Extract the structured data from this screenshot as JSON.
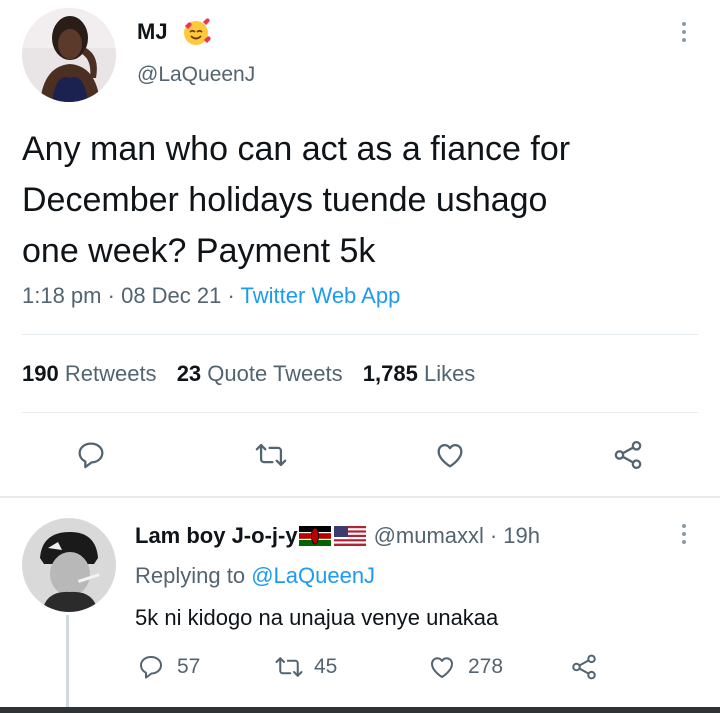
{
  "tweet": {
    "display_name": "MJ",
    "name_emoji": "smiling-face-with-hearts-icon",
    "handle": "@LaQueenJ",
    "text_line1": "Any man who can act as a fiance for",
    "text_line2": "December holidays tuende ushago",
    "text_line3": "one week? Payment 5k",
    "time": "1:18 pm",
    "sep1": "·",
    "date": "08 Dec 21",
    "sep2": "·",
    "source": "Twitter Web App",
    "stats": {
      "retweets_count": "190",
      "retweets_label": "Retweets",
      "quotes_count": "23",
      "quotes_label": "Quote Tweets",
      "likes_count": "1,785",
      "likes_label": "Likes"
    }
  },
  "reply": {
    "display_name": "Lam boy J-o-j-y",
    "flags": [
      "kenya-flag-icon",
      "us-flag-icon"
    ],
    "handle": "@mumaxxl",
    "sep": "·",
    "age": "19h",
    "replying_prefix": "Replying to",
    "replying_handle": "@LaQueenJ",
    "text": "5k ni kidogo na unajua venye unakaa",
    "reply_count": "57",
    "retweet_count": "45",
    "like_count": "278"
  },
  "colors": {
    "text": "#0f1419",
    "muted": "#536471",
    "accent": "#1d9bf0",
    "divider": "#e6ecf0"
  }
}
